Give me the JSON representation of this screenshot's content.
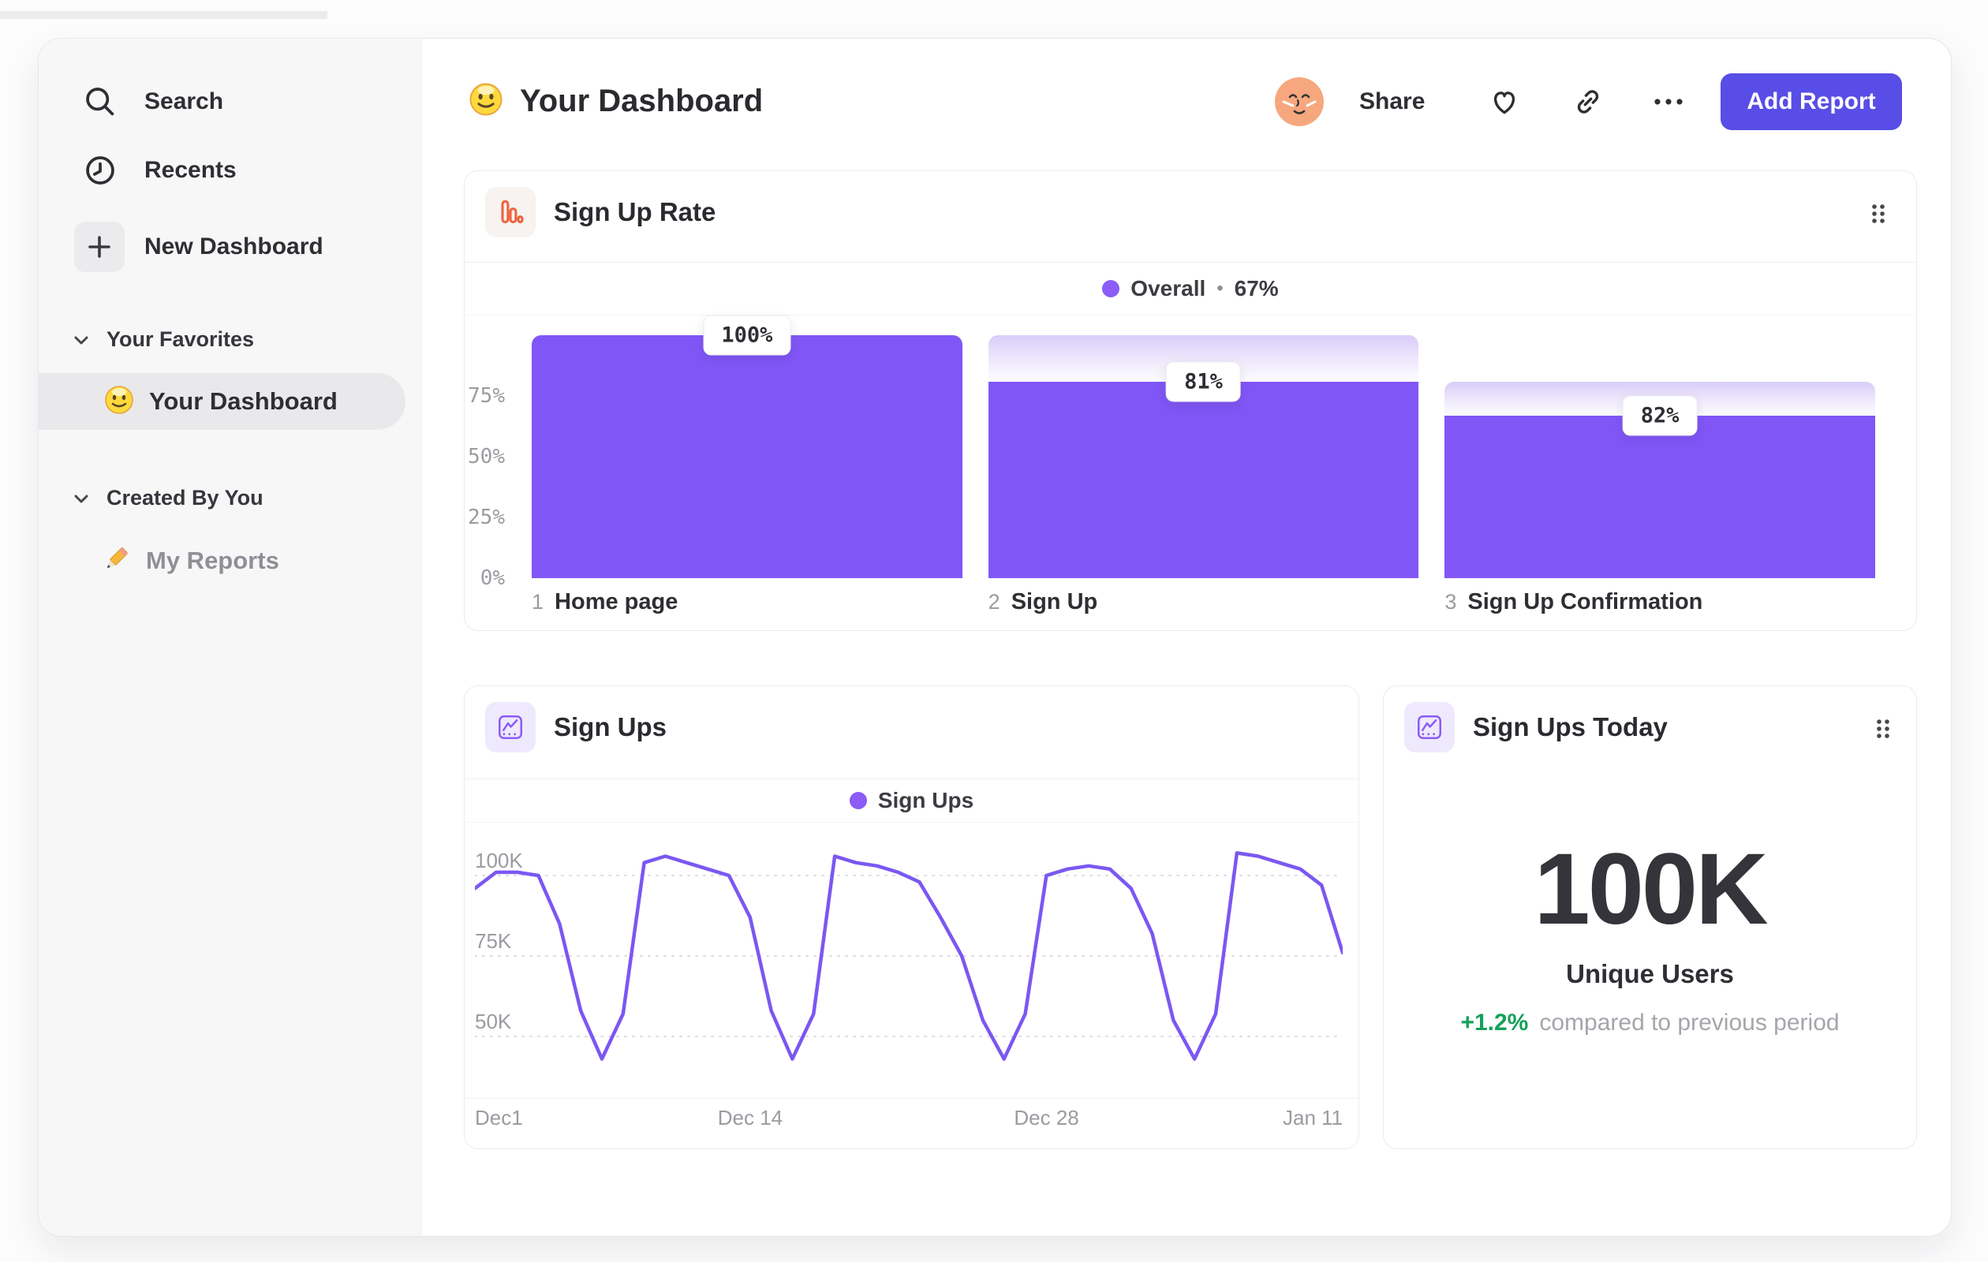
{
  "header": {
    "title": "Your Dashboard",
    "title_emoji": "slightly-smiling-face",
    "share_label": "Share",
    "add_report_label": "Add Report",
    "accent_color": "#584de6"
  },
  "sidebar": {
    "nav_items": [
      {
        "icon": "search-icon",
        "label": "Search"
      },
      {
        "icon": "clock-icon",
        "label": "Recents"
      },
      {
        "icon": "plus-icon",
        "label": "New Dashboard"
      }
    ],
    "sections": [
      {
        "label": "Your Favorites",
        "items": [
          {
            "icon": "smiley-emoji",
            "label": "Your Dashboard",
            "selected": true
          }
        ]
      },
      {
        "label": "Created By You",
        "items": [
          {
            "icon": "pencil-emoji",
            "label": "My Reports",
            "selected": false
          }
        ]
      }
    ]
  },
  "cards": {
    "sign_up_rate": {
      "title": "Sign Up Rate",
      "icon": "bar-chart-icon",
      "legend_series": "Overall",
      "legend_separator": "•",
      "legend_value": "67%"
    },
    "sign_ups": {
      "title": "Sign Ups",
      "icon": "line-chart-icon",
      "legend_series": "Sign Ups"
    },
    "sign_ups_today": {
      "title": "Sign Ups Today",
      "icon": "line-chart-icon",
      "value": "100K",
      "metric_label": "Unique Users",
      "delta": "+1.2%",
      "delta_color": "#14a05a",
      "delta_note": "compared to previous period"
    }
  },
  "chart_data": [
    {
      "type": "bar",
      "subtype": "funnel",
      "title": "Sign Up Rate",
      "legend": {
        "name": "Overall",
        "value": "67%"
      },
      "categories": [
        "Home page",
        "Sign Up",
        "Sign Up Confirmation"
      ],
      "step_numbers": [
        "1",
        "2",
        "3"
      ],
      "step_conversion_pct": [
        100,
        81,
        82
      ],
      "overall_pct": [
        100,
        81,
        67
      ],
      "bar_labels": [
        "100%",
        "81%",
        "82%"
      ],
      "y_ticks": [
        "75%",
        "50%",
        "25%",
        "0%"
      ],
      "y_tick_values": [
        75,
        50,
        25,
        0
      ],
      "ylim": [
        0,
        100
      ],
      "bar_color": "#8156f6",
      "ghost_gradient": [
        "#d9cdf8",
        "#ffffff"
      ],
      "legend_position": "top-center",
      "grid": "off"
    },
    {
      "type": "line",
      "title": "Sign Ups",
      "series": [
        {
          "name": "Sign Ups",
          "color": "#7b57f2",
          "values_thousands": [
            96,
            101,
            101,
            100,
            85,
            58,
            43,
            57,
            104,
            106,
            104,
            102,
            100,
            87,
            58,
            43,
            57,
            106,
            104,
            103,
            101,
            98,
            87,
            75,
            55,
            43,
            57,
            100,
            102,
            103,
            102,
            96,
            82,
            55,
            43,
            57,
            107,
            106,
            104,
            102,
            97,
            76
          ]
        }
      ],
      "x_tick_labels": [
        "Dec1",
        "Dec 14",
        "Dec 28",
        "Jan 11"
      ],
      "x_tick_day_index": [
        0,
        13,
        27,
        41
      ],
      "y_tick_labels": [
        "100K",
        "75K",
        "50K"
      ],
      "y_tick_values_thousands": [
        100,
        75,
        50
      ],
      "ylim_thousands": [
        40,
        110
      ],
      "grid": "dashed-horizontal",
      "grid_color": "#dcdce1",
      "legend_position": "top-center"
    }
  ]
}
